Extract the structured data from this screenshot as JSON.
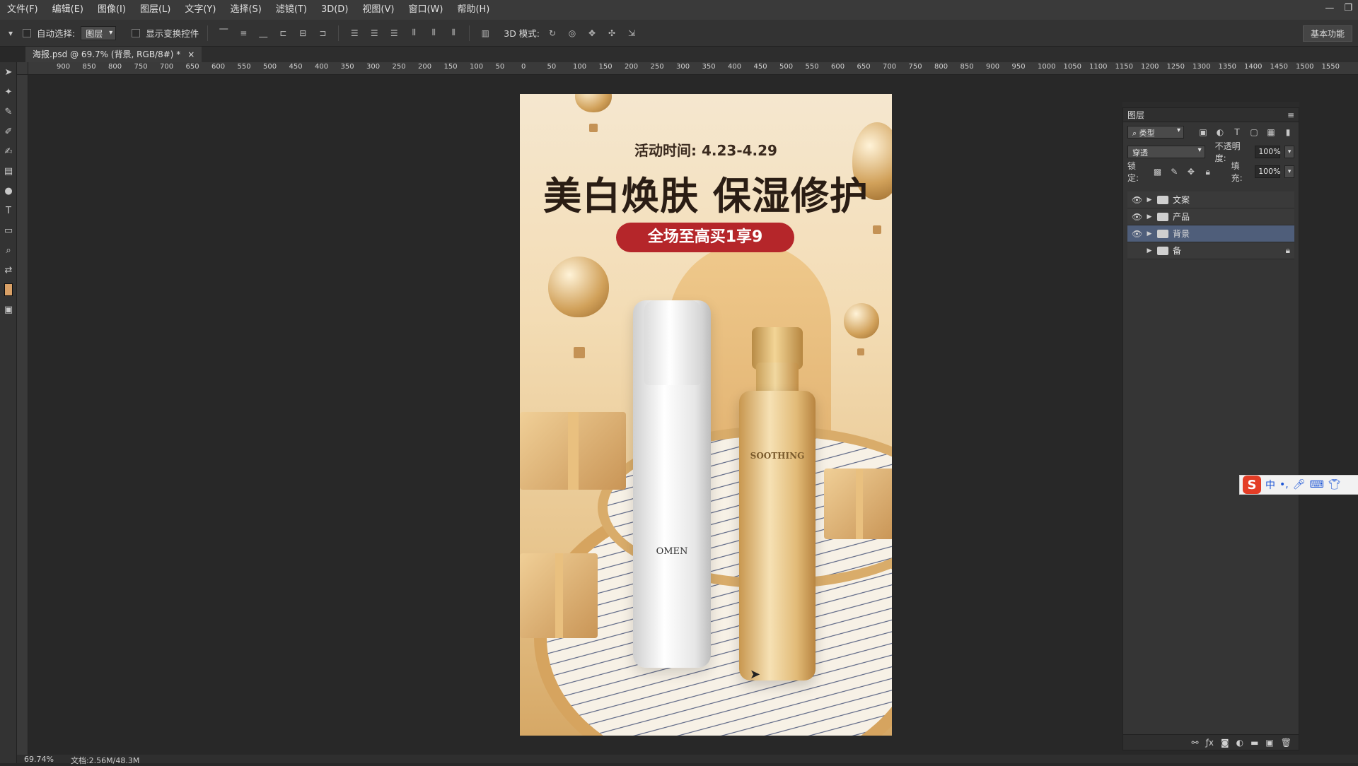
{
  "menubar": {
    "items": [
      "文件(F)",
      "编辑(E)",
      "图像(I)",
      "图层(L)",
      "文字(Y)",
      "选择(S)",
      "滤镜(T)",
      "3D(D)",
      "视图(V)",
      "窗口(W)",
      "帮助(H)"
    ]
  },
  "options": {
    "auto_select_label": "自动选择:",
    "auto_select_value": "图层",
    "show_transform_label": "显示变换控件",
    "mode_3d_label": "3D 模式:",
    "workspace_label": "基本功能"
  },
  "document": {
    "tab_label": "海报.psd @ 69.7% (背景, RGB/8#) *",
    "close_symbol": "×"
  },
  "ruler": {
    "top_labels": [
      "900",
      "850",
      "800",
      "750",
      "700",
      "650",
      "600",
      "550",
      "500",
      "450",
      "400",
      "350",
      "300",
      "250",
      "200",
      "150",
      "100",
      "50",
      "0",
      "50",
      "100",
      "150",
      "200",
      "250",
      "300",
      "350",
      "400",
      "450",
      "500",
      "550",
      "600",
      "650",
      "700",
      "750",
      "800",
      "850",
      "900",
      "950",
      "1000",
      "1050",
      "1100",
      "1150",
      "1200",
      "1250",
      "1300",
      "1350",
      "1400",
      "1450",
      "1500",
      "1550"
    ]
  },
  "poster": {
    "date_text": "活动时间: 4.23-4.29",
    "headline": "美白焕肤 保湿修护",
    "promo": "全场至高买1享9",
    "white_bottle_brand": "OMEN",
    "gold_bottle_label": "SOOTHING"
  },
  "layers_panel": {
    "title": "图层",
    "filter_label": "类型",
    "blend_mode": "穿透",
    "opacity_label": "不透明度:",
    "opacity_value": "100%",
    "lock_label": "锁定:",
    "fill_label": "填充:",
    "fill_value": "100%",
    "layers": [
      {
        "name": "文案",
        "visible": true,
        "selected": false,
        "locked": false
      },
      {
        "name": "产品",
        "visible": true,
        "selected": false,
        "locked": false
      },
      {
        "name": "背景",
        "visible": true,
        "selected": true,
        "locked": false
      },
      {
        "name": "备",
        "visible": false,
        "selected": false,
        "locked": true
      }
    ]
  },
  "status_bar": {
    "zoom": "69.74%",
    "doc_size": "文档:2.56M/48.3M"
  },
  "ime": {
    "lang": "中"
  },
  "colors": {
    "accent_pill": "#b5262a",
    "selected_layer": "#4f5e7a"
  }
}
